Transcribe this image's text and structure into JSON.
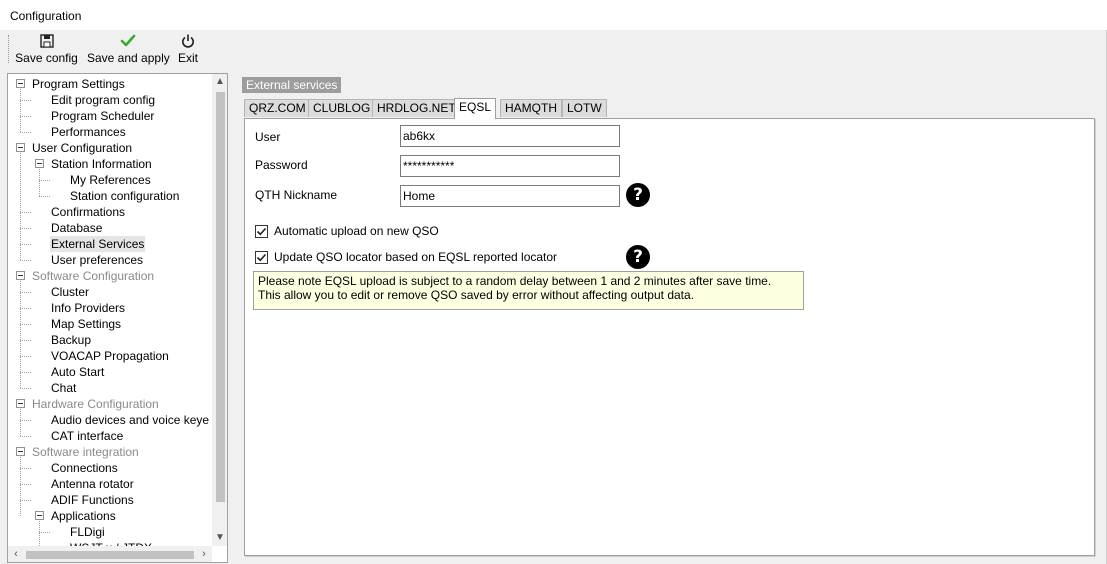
{
  "window": {
    "title": "Configuration"
  },
  "toolbar": {
    "save_config": {
      "label": "Save config",
      "icon": "floppy-disk-icon"
    },
    "save_apply": {
      "label": "Save and apply",
      "icon": "checkmark-icon"
    },
    "exit": {
      "label": "Exit",
      "icon": "power-icon"
    }
  },
  "tree": {
    "items": [
      {
        "label": "Program Settings",
        "level": 0,
        "expanded": true,
        "gray": false
      },
      {
        "label": "Edit program config",
        "level": 1
      },
      {
        "label": "Program Scheduler",
        "level": 1
      },
      {
        "label": "Performances",
        "level": 1
      },
      {
        "label": "User Configuration",
        "level": 0,
        "expanded": true,
        "gray": false
      },
      {
        "label": "Station Information",
        "level": 1,
        "expanded": true
      },
      {
        "label": "My References",
        "level": 2
      },
      {
        "label": "Station configuration",
        "level": 2
      },
      {
        "label": "Confirmations",
        "level": 1
      },
      {
        "label": "Database",
        "level": 1
      },
      {
        "label": "External Services",
        "level": 1,
        "selected": true
      },
      {
        "label": "User preferences",
        "level": 1
      },
      {
        "label": "Software Configuration",
        "level": 0,
        "expanded": true,
        "gray": true
      },
      {
        "label": "Cluster",
        "level": 1
      },
      {
        "label": "Info Providers",
        "level": 1
      },
      {
        "label": "Map Settings",
        "level": 1
      },
      {
        "label": "Backup",
        "level": 1
      },
      {
        "label": "VOACAP Propagation",
        "level": 1
      },
      {
        "label": "Auto Start",
        "level": 1
      },
      {
        "label": "Chat",
        "level": 1
      },
      {
        "label": "Hardware Configuration",
        "level": 0,
        "expanded": true,
        "gray": true
      },
      {
        "label": "Audio devices and voice keye",
        "level": 1
      },
      {
        "label": "CAT interface",
        "level": 1
      },
      {
        "label": "Software integration",
        "level": 0,
        "expanded": true,
        "gray": true
      },
      {
        "label": "Connections",
        "level": 1
      },
      {
        "label": "Antenna rotator",
        "level": 1
      },
      {
        "label": "ADIF Functions",
        "level": 1
      },
      {
        "label": "Applications",
        "level": 1,
        "expanded": true
      },
      {
        "label": "FLDigi",
        "level": 2
      },
      {
        "label": "WSJT-x / JTDX",
        "level": 2
      }
    ]
  },
  "panel": {
    "group_caption": "External services",
    "tabs": [
      "QRZ.COM",
      "CLUBLOG",
      "HRDLOG.NET",
      "EQSL",
      "HAMQTH",
      "LOTW"
    ],
    "active_tab": "EQSL",
    "user_label": "User",
    "user_value": "ab6kx",
    "password_label": "Password",
    "password_value": "***********",
    "qth_label": "QTH Nickname",
    "qth_value": "Home",
    "auto_upload_label": "Automatic upload on new QSO",
    "auto_upload_checked": true,
    "update_locator_label": "Update QSO locator based on EQSL reported locator",
    "update_locator_checked": true,
    "help_glyph": "?",
    "note_line1": "Please note EQSL upload is subject to a random delay between 1 and 2 minutes after save time.",
    "note_line2": "This allow you to edit or remove QSO saved by error without affecting output data."
  },
  "colors": {
    "caption_bg": "#9d9d9d",
    "note_bg": "#ffffe1",
    "check_green": "#3aa83a"
  }
}
